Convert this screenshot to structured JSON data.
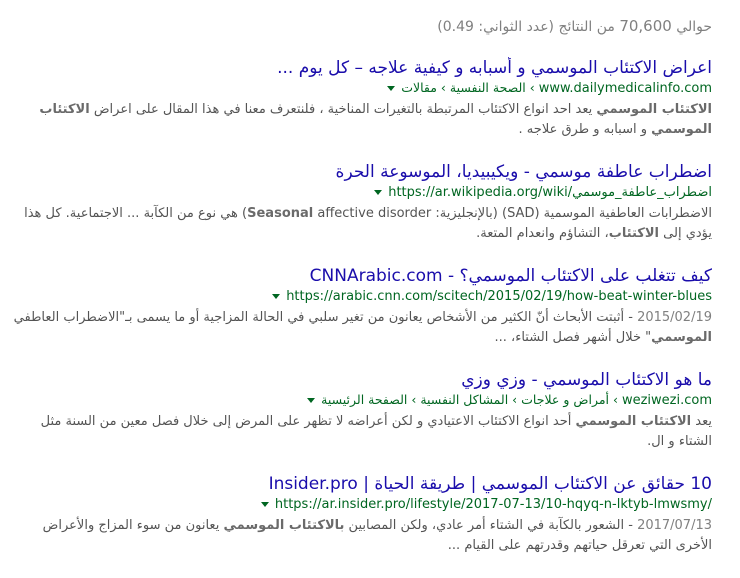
{
  "stats": {
    "prefix": "حوالي",
    "count": "70,600",
    "suffix": "من النتائج (عدد الثواني: 0.49)"
  },
  "results": [
    {
      "title": "اعراض الاكتئاب الموسمي و أسبابه و كيفية علاجه – كل يوم ...",
      "url": "www.dailymedicalinfo.com",
      "breadcrumbs": [
        "الصحة النفسية",
        "مقالات"
      ],
      "date": "",
      "snippet": [
        {
          "t": "الاكتئاب الموسمي",
          "b": true
        },
        {
          "t": " يعد احد انواع الاكتئاب المرتبطة بالتغيرات المناخية ، فلنتعرف معنا في هذا المقال على اعراض ",
          "b": false
        },
        {
          "t": "الاكتئاب الموسمي",
          "b": true
        },
        {
          "t": " و اسبابه و طرق علاجه .",
          "b": false
        }
      ]
    },
    {
      "title": "اضطراب عاطفة موسمي - ويكيبيديا، الموسوعة الحرة",
      "url": "https://ar.wikipedia.org/wiki/اضطراب_عاطفة_موسمي",
      "breadcrumbs": [],
      "date": "",
      "snippet": [
        {
          "t": "الاضطرابات العاطفية الموسمية (SAD) (بالإنجليزية: ",
          "b": false
        },
        {
          "t": "Seasonal",
          "b": true
        },
        {
          "t": " affective disorder) هي نوع من الكآبة ... الاجتماعية. كل هذا يؤدي إلى ",
          "b": false
        },
        {
          "t": "الاكتئاب",
          "b": true
        },
        {
          "t": "، التشاؤم وانعدام المتعة.",
          "b": false
        }
      ]
    },
    {
      "title": "كيف تتغلب على الاكتئاب الموسمي؟ - CNNArabic.com",
      "url": "https://arabic.cnn.com/scitech/2015/02/19/how-beat-winter-blues",
      "breadcrumbs": [],
      "date": "2015/02/19",
      "snippet": [
        {
          "t": " - أثبتت الأبحاث أنّ الكثير من الأشخاص يعانون من تغير سلبي في الحالة المزاجية أو ما يسمى بـ\"الاضطراب العاطفي ",
          "b": false
        },
        {
          "t": "الموسمي",
          "b": true
        },
        {
          "t": "\" خلال أشهر فصل الشتاء، ...",
          "b": false
        }
      ]
    },
    {
      "title": "ما هو الاكتئاب الموسمي - وزي وزي",
      "url": "weziwezi.com",
      "breadcrumbs": [
        "أمراض و علاجات",
        "المشاكل النفسية",
        "الصفحة الرئيسية"
      ],
      "date": "",
      "snippet": [
        {
          "t": "يعد ",
          "b": false
        },
        {
          "t": "الاكتئاب الموسمي",
          "b": true
        },
        {
          "t": " أحد انواع الاكتئاب الاعتيادي و لكن أعراضه لا تظهر على المرض إلى خلال فصل معين من السنة مثل الشتاء و ال.",
          "b": false
        }
      ]
    },
    {
      "title": "10 حقائق عن الاكتئاب الموسمي | طريقة الحياة | Insider.pro",
      "url": "https://ar.insider.pro/lifestyle/2017-07-13/10-hqyq-n-lktyb-lmwsmy/",
      "breadcrumbs": [],
      "date": "2017/07/13",
      "snippet": [
        {
          "t": " - الشعور بالكآبة في الشتاء أمر عادي، ولكن المصابين ",
          "b": false
        },
        {
          "t": "بالاكتئاب الموسمي",
          "b": true
        },
        {
          "t": " يعانون من سوء المزاج والأعراض الأخرى التي تعرقل حياتهم وقدرتهم على القيام ...",
          "b": false
        }
      ]
    }
  ]
}
